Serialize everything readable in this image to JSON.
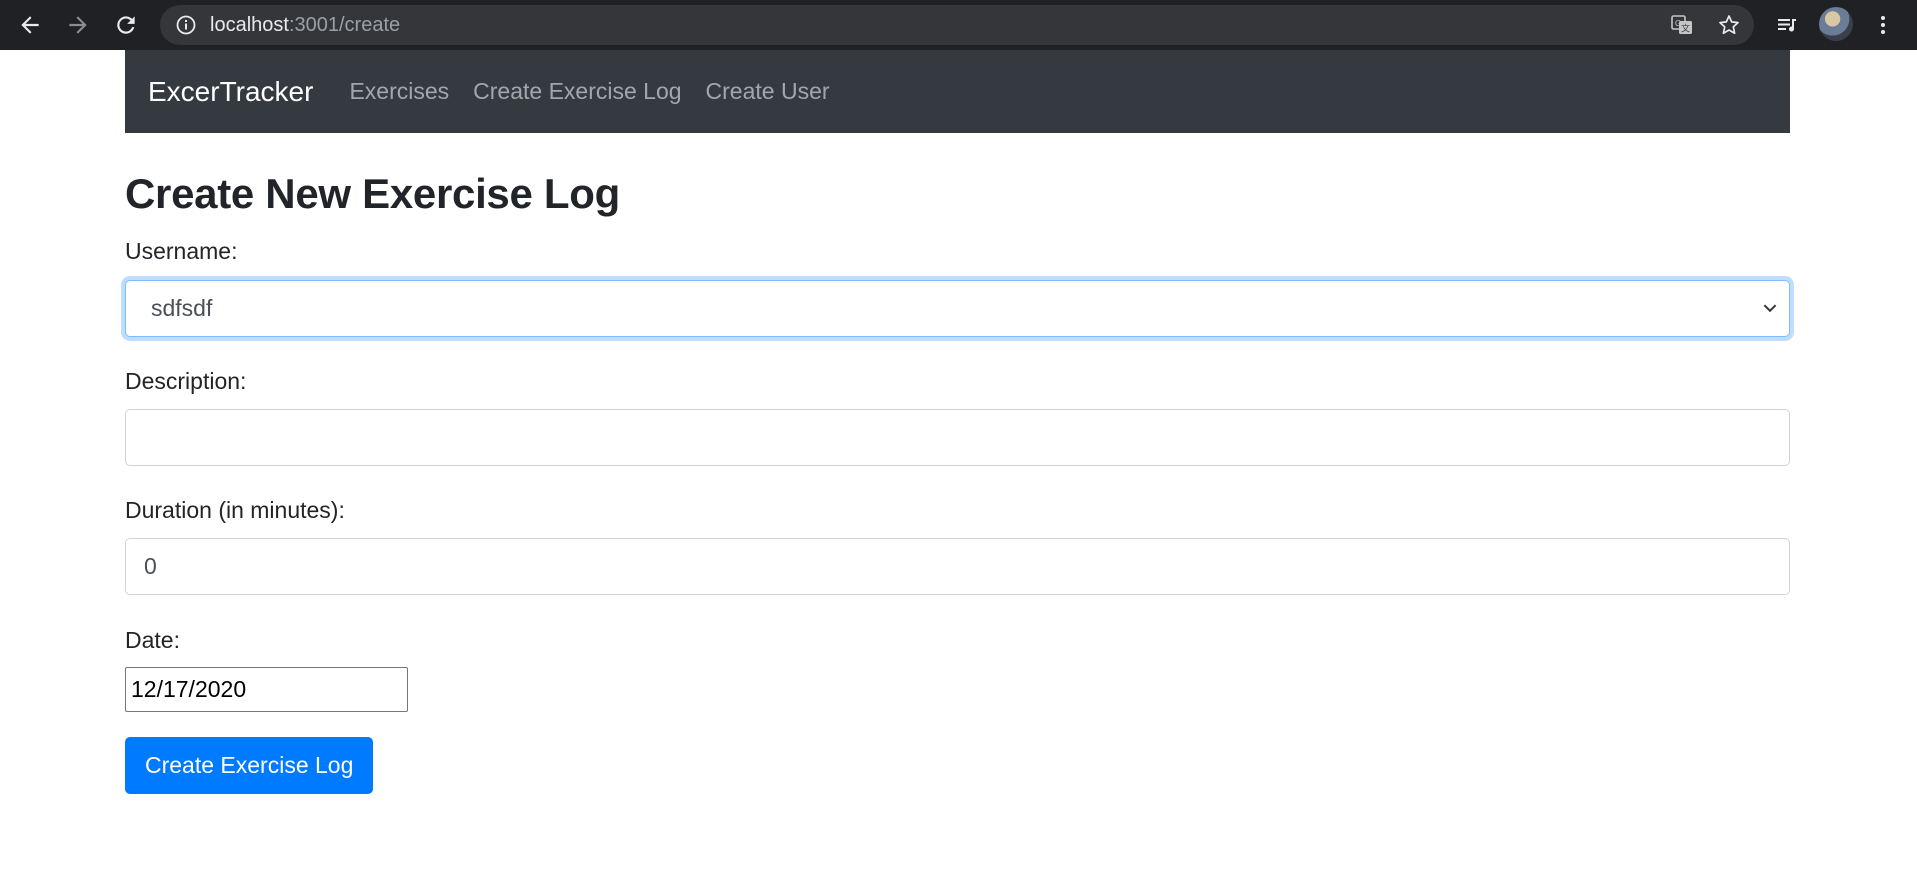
{
  "browser": {
    "url_host": "localhost",
    "url_rest": ":3001/create",
    "icons": [
      "back-icon",
      "forward-icon",
      "reload-icon",
      "info-icon",
      "translate-icon",
      "star-icon",
      "media-queue-icon",
      "avatar",
      "more-icon"
    ]
  },
  "navbar": {
    "brand": "ExcerTracker",
    "links": [
      "Exercises",
      "Create Exercise Log",
      "Create User"
    ]
  },
  "page": {
    "title": "Create New Exercise Log"
  },
  "form": {
    "username_label": "Username:",
    "username_value": "sdfsdf",
    "description_label": "Description:",
    "description_value": "",
    "duration_label": "Duration (in minutes):",
    "duration_value": "0",
    "date_label": "Date:",
    "date_value": "12/17/2020",
    "submit_label": "Create Exercise Log"
  },
  "colors": {
    "navbar_bg": "#343a40",
    "primary": "#007bff",
    "focus_border": "#80bdff"
  }
}
